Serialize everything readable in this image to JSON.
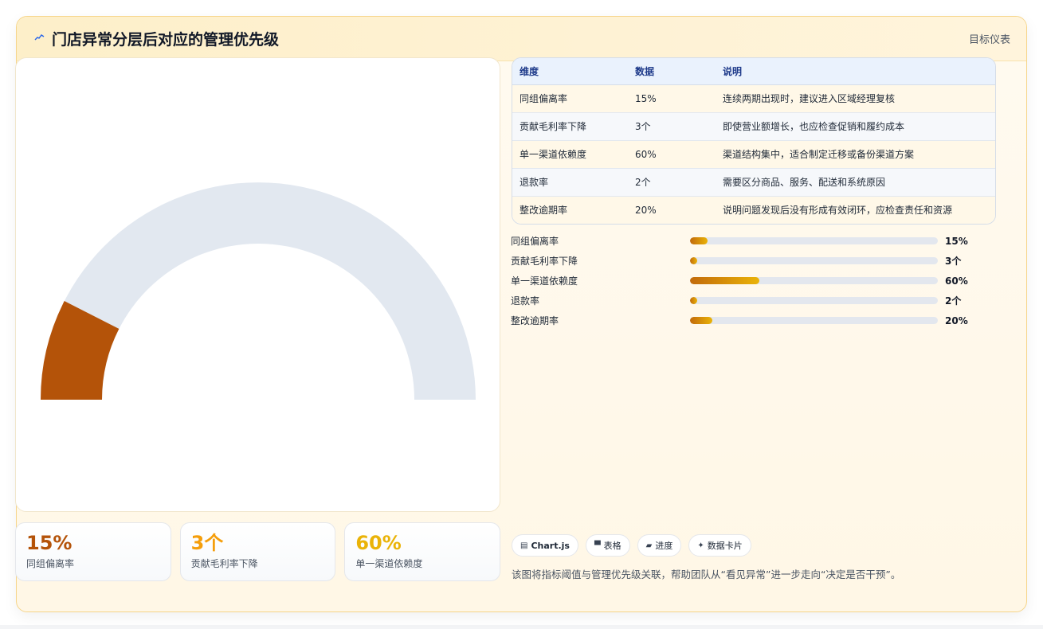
{
  "header": {
    "icon": "sparkline-icon",
    "title": "门店异常分层后对应的管理优先级",
    "link": "目标仪表"
  },
  "gauge": {
    "value_percent": 15,
    "fill_color": "#b45309",
    "track_color": "#e2e8f0"
  },
  "kpis": [
    {
      "value": "15%",
      "label": "同组偏离率",
      "color": "#b45309"
    },
    {
      "value": "3个",
      "label": "贡献毛利率下降",
      "color": "#f59e0b"
    },
    {
      "value": "60%",
      "label": "单一渠道依赖度",
      "color": "#eab308"
    }
  ],
  "table": {
    "headers": [
      "维度",
      "数据",
      "说明"
    ],
    "rows": [
      [
        "同组偏离率",
        "15%",
        "连续两期出现时，建议进入区域经理复核"
      ],
      [
        "贡献毛利率下降",
        "3个",
        "即使营业额增长，也应检查促销和履约成本"
      ],
      [
        "单一渠道依赖度",
        "60%",
        "渠道结构集中，适合制定迁移或备份渠道方案"
      ],
      [
        "退款率",
        "2个",
        "需要区分商品、服务、配送和系统原因"
      ],
      [
        "整改逾期率",
        "20%",
        "说明问题发现后没有形成有效闭环，应检查责任和资源"
      ]
    ]
  },
  "bars": [
    {
      "label": "同组偏离率",
      "value": "15%",
      "level": 0.07
    },
    {
      "label": "贡献毛利率下降",
      "value": "3个",
      "level": 0.03
    },
    {
      "label": "单一渠道依赖度",
      "value": "60%",
      "level": 0.28
    },
    {
      "label": "退款率",
      "value": "2个",
      "level": 0.03
    },
    {
      "label": "整改逾期率",
      "value": "20%",
      "level": 0.09
    }
  ],
  "chips": [
    {
      "icon": "chart-icon",
      "glyph": "▤",
      "label": "Chart.js"
    },
    {
      "icon": "table-icon",
      "glyph": "▀",
      "label": "表格"
    },
    {
      "icon": "progress-icon",
      "glyph": "▰",
      "label": "进度"
    },
    {
      "icon": "sparkle-icon",
      "glyph": "✦",
      "label": "数据卡片"
    }
  ],
  "footnote": "该图将指标阈值与管理优先级关联，帮助团队从“看见异常”进一步走向“决定是否干预”。"
}
